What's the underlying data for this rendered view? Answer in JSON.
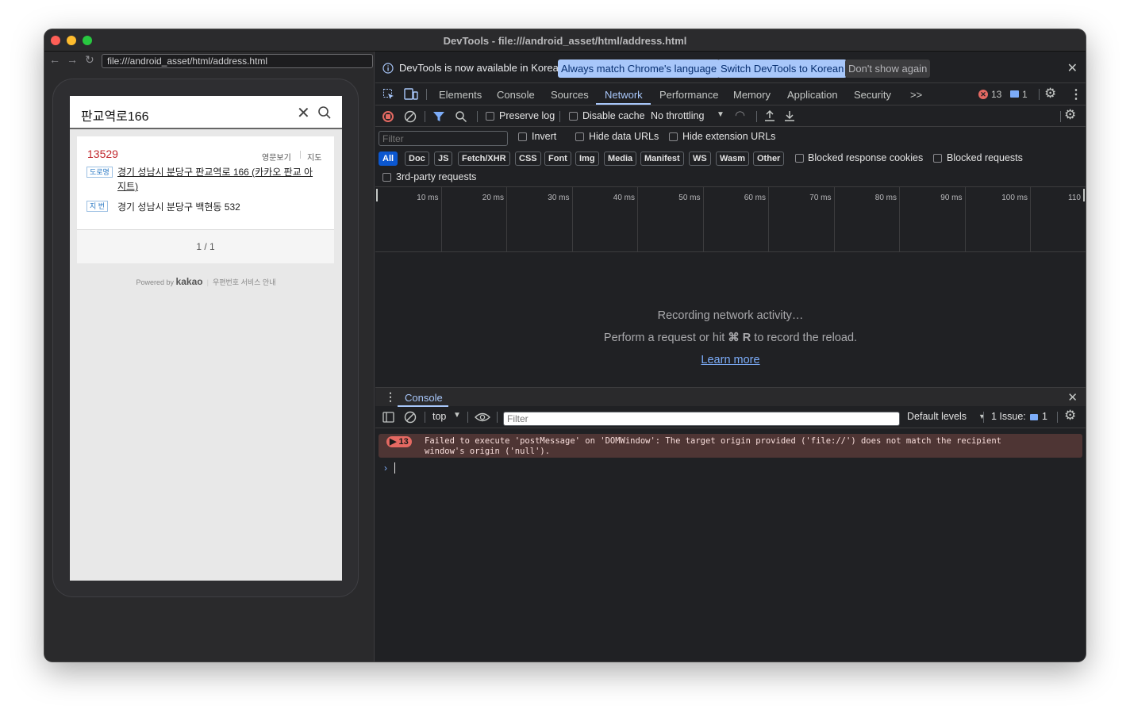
{
  "window": {
    "title": "DevTools - file:///android_asset/html/address.html"
  },
  "browser": {
    "url": "file:///android_asset/html/address.html"
  },
  "app": {
    "search_query": "판교역로166",
    "result": {
      "zipcode": "13529",
      "english_link": "영문보기",
      "map_link": "지도",
      "road_tag": "도로명",
      "road_address_line1": "경기 성남시 분당구 판교역로 166 (카카오 판교 아",
      "road_address_line2": "지트)",
      "jibun_tag": "지 번",
      "jibun_address": "경기 성남시 분당구 백현동 532"
    },
    "pager": "1 / 1",
    "powered_by": "Powered by",
    "brand": "kakao",
    "service_info": "우편번호 서비스 안내"
  },
  "devtools": {
    "infobar": {
      "text": "DevTools is now available in Korean!",
      "btn_match": "Always match Chrome's language",
      "btn_switch": "Switch DevTools to Korean",
      "btn_dismiss": "Don't show again"
    },
    "tabs": [
      "Elements",
      "Console",
      "Sources",
      "Network",
      "Performance",
      "Memory",
      "Application",
      "Security"
    ],
    "active_tab": "Network",
    "more_tabs": ">>",
    "error_count": "13",
    "message_count": "1",
    "network": {
      "preserve_log": "Preserve log",
      "disable_cache": "Disable cache",
      "throttling": "No throttling",
      "filter_placeholder": "Filter",
      "invert": "Invert",
      "hide_data_urls": "Hide data URLs",
      "hide_extension_urls": "Hide extension URLs",
      "types": [
        "All",
        "Doc",
        "JS",
        "Fetch/XHR",
        "CSS",
        "Font",
        "Img",
        "Media",
        "Manifest",
        "WS",
        "Wasm",
        "Other"
      ],
      "selected_type": "All",
      "blocked_cookies": "Blocked response cookies",
      "blocked_requests": "Blocked requests",
      "third_party": "3rd-party requests",
      "timeline_ticks": [
        "10 ms",
        "20 ms",
        "30 ms",
        "40 ms",
        "50 ms",
        "60 ms",
        "70 ms",
        "80 ms",
        "90 ms",
        "100 ms",
        "110"
      ],
      "recording": "Recording network activity…",
      "hint_pre": "Perform a request or hit",
      "hint_key": "⌘ R",
      "hint_post": "to record the reload.",
      "learn_more": "Learn more"
    },
    "drawer": {
      "tab": "Console",
      "context": "top",
      "filter_placeholder": "Filter",
      "levels": "Default levels",
      "issues_label": "1 Issue:",
      "issues_count": "1",
      "error_badge": "13",
      "error_message": "Failed to execute 'postMessage' on 'DOMWindow': The target origin provided ('file://') does not match the recipient window's origin ('null')."
    },
    "colors": {
      "accent": "#a8c7fa",
      "error": "#e46962",
      "panel_bg": "#202124"
    }
  }
}
